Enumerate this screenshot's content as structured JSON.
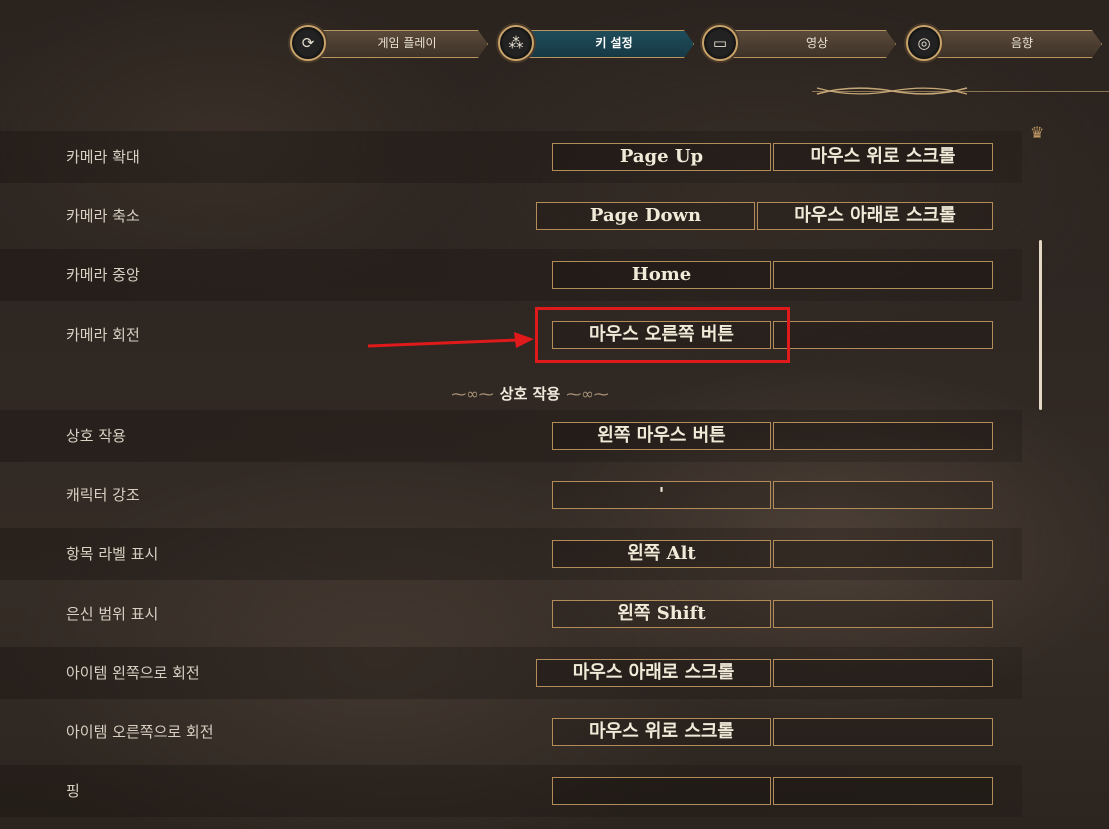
{
  "tabs": [
    {
      "label": "게임 플레이",
      "icon": "gameplay-icon",
      "active": false
    },
    {
      "label": "키 설정",
      "icon": "keybind-icon",
      "active": true
    },
    {
      "label": "영상",
      "icon": "monitor-icon",
      "active": false
    },
    {
      "label": "음향",
      "icon": "speaker-icon",
      "active": false
    }
  ],
  "section_title": "상호 작용",
  "rows": [
    {
      "name": "카메라 확대",
      "primary": "Page Up",
      "secondary": "마우스 위로 스크롤"
    },
    {
      "name": "카메라 축소",
      "primary": "Page Down",
      "secondary": "마우스 아래로 스크롤"
    },
    {
      "name": "카메라 중앙",
      "primary": "Home",
      "secondary": ""
    },
    {
      "name": "카메라 회전",
      "primary": "마우스 오른쪽 버튼",
      "secondary": ""
    },
    {
      "name": "상호 작용",
      "primary": "왼쪽 마우스 버튼",
      "secondary": ""
    },
    {
      "name": "캐릭터 강조",
      "primary": "'",
      "secondary": ""
    },
    {
      "name": "항목 라벨 표시",
      "primary": "왼쪽 Alt",
      "secondary": ""
    },
    {
      "name": "은신 범위 표시",
      "primary": "왼쪽 Shift",
      "secondary": ""
    },
    {
      "name": "아이템 왼쪽으로 회전",
      "primary": "마우스 아래로 스크롤",
      "secondary": ""
    },
    {
      "name": "아이템 오른쪽으로 회전",
      "primary": "마우스 위로 스크롤",
      "secondary": ""
    },
    {
      "name": "핑",
      "primary": "",
      "secondary": ""
    }
  ],
  "colors": {
    "highlight": "#e0191b",
    "border": "#b48c5a",
    "active_tab": "#1f4c5a"
  }
}
